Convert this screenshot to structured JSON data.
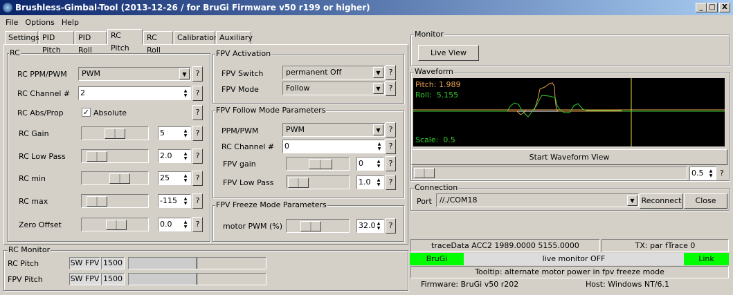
{
  "window": {
    "title": "Brushless-Gimbal-Tool (2013-12-26 / for BruGi Firmware v50 r199 or higher)",
    "minimize": "_",
    "maximize": "□",
    "close": "X"
  },
  "menu": [
    "File",
    "Options",
    "Help"
  ],
  "tabs": [
    "Settings",
    "PID Pitch",
    "PID Roll",
    "RC Pitch",
    "RC Roll",
    "Calibration",
    "Auxiliary"
  ],
  "active_tab": "RC Pitch",
  "help": "?",
  "rc": {
    "title": "RC",
    "ppm_label": "RC PPM/PWM",
    "ppm_value": "PWM",
    "channel_label": "RC Channel #",
    "channel_value": "2",
    "absprop_label": "RC Abs/Prop",
    "absolute_label": "Absolute",
    "absolute_checked": true,
    "sliders": [
      {
        "label": "RC Gain",
        "value": "5"
      },
      {
        "label": "RC Low Pass",
        "value": "2.0"
      },
      {
        "label": "RC min",
        "value": "25"
      },
      {
        "label": "RC max",
        "value": "-115"
      },
      {
        "label": "Zero Offset",
        "value": "0.0"
      }
    ]
  },
  "fpv_activation": {
    "title": "FPV Activation",
    "switch_label": "FPV Switch",
    "switch_value": "permanent Off",
    "mode_label": "FPV Mode",
    "mode_value": "Follow"
  },
  "fpv_follow": {
    "title": "FPV Follow Mode Parameters",
    "ppm_label": "PPM/PWM",
    "ppm_value": "PWM",
    "channel_label": "RC Channel #",
    "channel_value": "0",
    "gain_label": "FPV gain",
    "gain_value": "0",
    "lowpass_label": "FPV Low Pass",
    "lowpass_value": "1.0"
  },
  "fpv_freeze": {
    "title": "FPV Freeze Mode Parameters",
    "pwm_label": "motor PWM (%)",
    "pwm_value": "32.0"
  },
  "rc_monitor": {
    "title": "RC Monitor",
    "rows": [
      {
        "label": "RC Pitch",
        "sw": "SW FPV",
        "value": "1500",
        "level": 0.5
      },
      {
        "label": "FPV Pitch",
        "sw": "SW FPV",
        "value": "1500",
        "level": 0.5
      }
    ]
  },
  "monitor": {
    "title": "Monitor",
    "live_view": "Live View"
  },
  "waveform": {
    "title": "Waveform",
    "pitch": "Pitch: 1.989",
    "roll": "Roll:  5.155",
    "scale": "Scale:  0.5",
    "start": "Start Waveform View",
    "scale_value": "0.5",
    "colors": {
      "pitch": "#e8a050",
      "roll": "#30d030",
      "cursor": "#e0e040"
    }
  },
  "connection": {
    "title": "Connection",
    "port_label": "Port",
    "port_value": "//./COM18",
    "reconnect": "Reconnect",
    "close": "Close"
  },
  "status": {
    "trace": "traceData ACC2 1989.0000 5155.0000",
    "tx": "TX: par fTrace 0",
    "brugi": "BruGi",
    "live": "live monitor OFF",
    "link": "Link",
    "tooltip": "Tooltip: alternate motor power in fpv freeze mode",
    "firmware": "Firmware: BruGi v50 r202",
    "host": "Host: Windows NT/6.1"
  }
}
